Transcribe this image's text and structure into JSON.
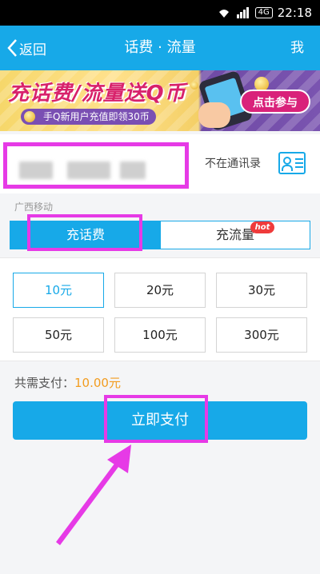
{
  "status_bar": {
    "network_badge": "4G",
    "time": "22:18"
  },
  "nav": {
    "back_label": "返回",
    "title": "话费 · 流量",
    "me_label": "我"
  },
  "banner": {
    "headline": "充话费/流量送Q币",
    "subline": "手Q新用户充值即领30币",
    "cta_label": "点击参与"
  },
  "phone": {
    "value_masked": true,
    "not_in_contacts": "不在通讯录"
  },
  "carrier": "广西移动",
  "tabs": [
    {
      "label": "充话费",
      "active": true
    },
    {
      "label": "充流量",
      "active": false,
      "badge": "hot"
    }
  ],
  "amounts": [
    {
      "label": "10元",
      "selected": true
    },
    {
      "label": "20元",
      "selected": false
    },
    {
      "label": "30元",
      "selected": false
    },
    {
      "label": "50元",
      "selected": false
    },
    {
      "label": "100元",
      "selected": false
    },
    {
      "label": "300元",
      "selected": false
    }
  ],
  "total": {
    "label": "共需支付：",
    "price": "10.00元"
  },
  "pay_button_label": "立即支付",
  "colors": {
    "accent": "#17a9e8",
    "highlight_annotation": "#e63ae6",
    "price": "#f29c1f",
    "hot_badge": "#ef3b3b"
  }
}
